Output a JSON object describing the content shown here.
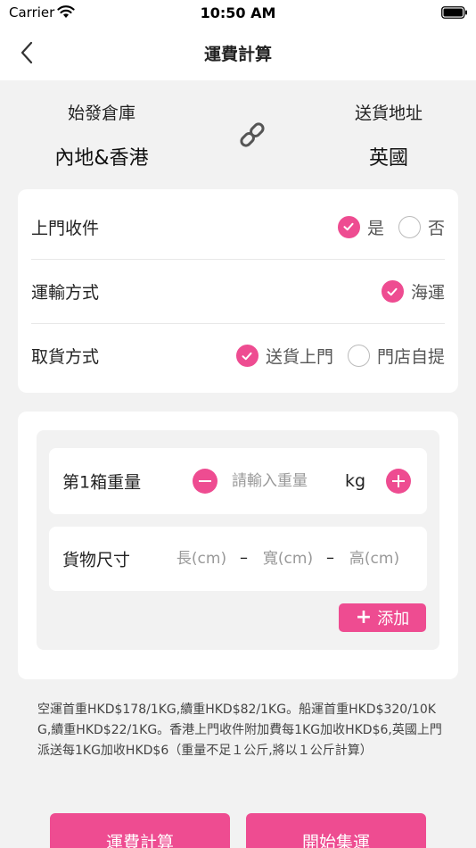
{
  "status_bar": {
    "carrier": "Carrier",
    "time": "10:50 AM"
  },
  "nav": {
    "title": "運費計算",
    "back_icon": "chevron-left-icon"
  },
  "route": {
    "origin_label": "始發倉庫",
    "origin_value": "內地&香港",
    "destination_label": "送貨地址",
    "destination_value": "英國",
    "link_icon": "link-icon"
  },
  "options": {
    "pickup": {
      "label": "上門收件",
      "choices": [
        {
          "label": "是",
          "selected": true
        },
        {
          "label": "否",
          "selected": false
        }
      ]
    },
    "transport": {
      "label": "運輸方式",
      "choices": [
        {
          "label": "海運",
          "selected": true
        }
      ]
    },
    "delivery": {
      "label": "取貨方式",
      "choices": [
        {
          "label": "送貨上門",
          "selected": true
        },
        {
          "label": "門店自提",
          "selected": false
        }
      ]
    }
  },
  "parcel": {
    "weight_label": "第1箱重量",
    "weight_placeholder": "請輸入重量",
    "weight_unit": "kg",
    "size_label": "貨物尺寸",
    "length_placeholder": "長(cm)",
    "width_placeholder": "寬(cm)",
    "height_placeholder": "高(cm)",
    "separator": "–",
    "add_label": "添加"
  },
  "note": "空運首重HKD$178/1KG,續重HKD$82/1KG。船運首重HKD$320/10KG,續重HKD$22/1KG。香港上門收件附加費每1KG加收HKD$6,英國上門派送每1KG加收HKD$6（重量不足１公斤,將以１公斤計算）",
  "buttons": {
    "calculate": "運費計算",
    "start": "開始集運"
  },
  "colors": {
    "accent": "#ee4c91",
    "background": "#f2f2f2",
    "card": "#ffffff"
  }
}
